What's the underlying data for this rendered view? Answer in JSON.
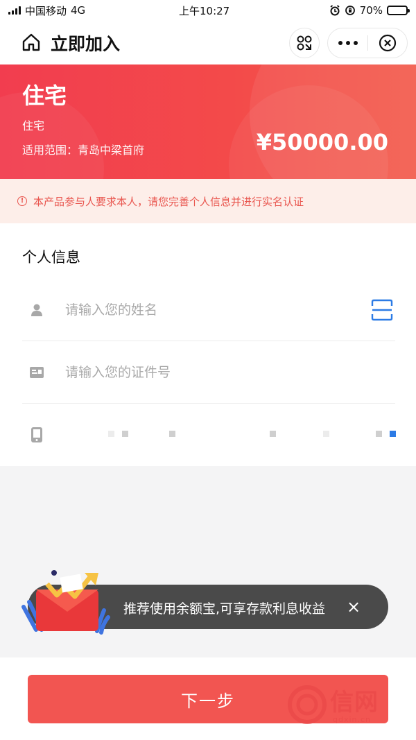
{
  "status_bar": {
    "carrier": "中国移动",
    "network": "4G",
    "time": "上午10:27",
    "battery": "70%",
    "battery_level": 0.7
  },
  "nav": {
    "title": "立即加入"
  },
  "banner": {
    "title": "住宅",
    "subtitle": "住宅",
    "scope": "适用范围：青岛中梁首府",
    "amount": "¥50000.00"
  },
  "notice": {
    "text": "本产品参与人要求本人，请您完善个人信息并进行实名认证"
  },
  "form": {
    "section_title": "个人信息",
    "name_placeholder": "请输入您的姓名",
    "id_placeholder": "请输入您的证件号"
  },
  "toast": {
    "text": "推荐使用余额宝,可享存款利息收益",
    "close": "×"
  },
  "bottom": {
    "next_label": "下一步"
  },
  "watermark": {
    "brand": "信网",
    "domain": "qdxin.cn"
  },
  "colors": {
    "brand_red": "#f23d4f",
    "button_red": "#f25551",
    "notice_bg": "#fdeee9",
    "notice_text": "#e9564f",
    "scan_blue": "#2c7be5"
  }
}
